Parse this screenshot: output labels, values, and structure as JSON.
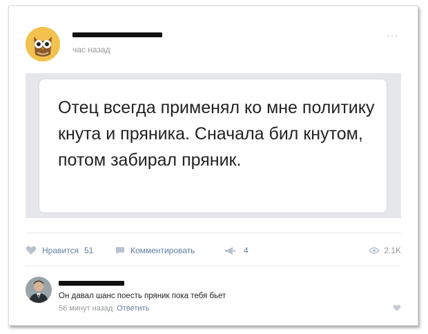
{
  "post": {
    "time": "час назад",
    "more": "···",
    "quote": "Отец всегда применял ко мне политику кнута и пряника. Сначала бил кнутом, потом забирал пряник."
  },
  "actions": {
    "like_label": "Нравится",
    "like_count": "51",
    "comment_label": "Комментировать",
    "share_count": "4",
    "views": "2.1K"
  },
  "comment": {
    "text": "Он давал шанс поесть пряник пока тебя бьет",
    "time": "56 минут назад",
    "reply": "Ответить"
  },
  "colors": {
    "link": "#5e7ea1",
    "muted": "#939699",
    "frame": "#e5e7ea"
  }
}
